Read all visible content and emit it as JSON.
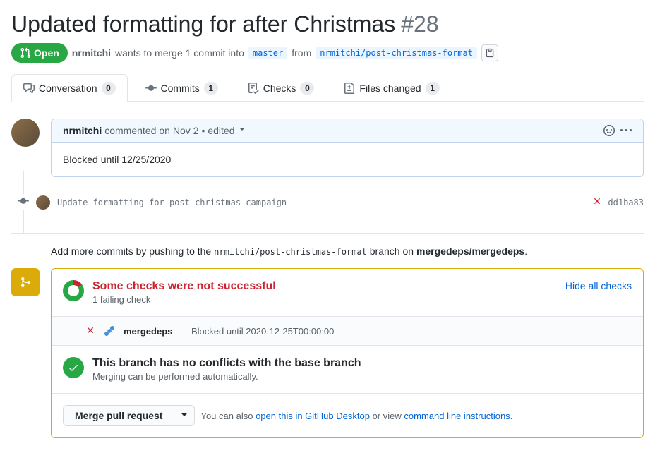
{
  "header": {
    "title": "Updated formatting for after Christmas",
    "number": "#28",
    "state": "Open",
    "author": "nrmitchi",
    "merge_text_1": "wants to merge 1 commit into",
    "base_branch": "master",
    "merge_text_2": "from",
    "head_branch": "nrmitchi/post-christmas-format"
  },
  "tabs": [
    {
      "label": "Conversation",
      "count": "0",
      "icon": "comment"
    },
    {
      "label": "Commits",
      "count": "1",
      "icon": "commit"
    },
    {
      "label": "Checks",
      "count": "0",
      "icon": "checklist"
    },
    {
      "label": "Files changed",
      "count": "1",
      "icon": "diff"
    }
  ],
  "comment": {
    "author": "nrmitchi",
    "action": "commented",
    "date": "on Nov 2",
    "edited": "edited",
    "body": "Blocked until 12/25/2020"
  },
  "commit": {
    "message": "Update formatting for post-christmas campaign",
    "sha": "dd1ba83"
  },
  "push_hint": {
    "prefix": "Add more commits by pushing to the",
    "branch": "nrmitchi/post-christmas-format",
    "middle": "branch on",
    "repo": "mergedeps/mergedeps"
  },
  "checks": {
    "heading": "Some checks were not successful",
    "sub": "1 failing check",
    "hide_link": "Hide all checks",
    "items": [
      {
        "name": "mergedeps",
        "detail": "— Blocked until 2020-12-25T00:00:00"
      }
    ]
  },
  "conflicts": {
    "heading": "This branch has no conflicts with the base branch",
    "sub": "Merging can be performed automatically."
  },
  "merge": {
    "button": "Merge pull request",
    "hint_prefix": "You can also",
    "link1": "open this in GitHub Desktop",
    "hint_mid": "or view",
    "link2": "command line instructions"
  }
}
